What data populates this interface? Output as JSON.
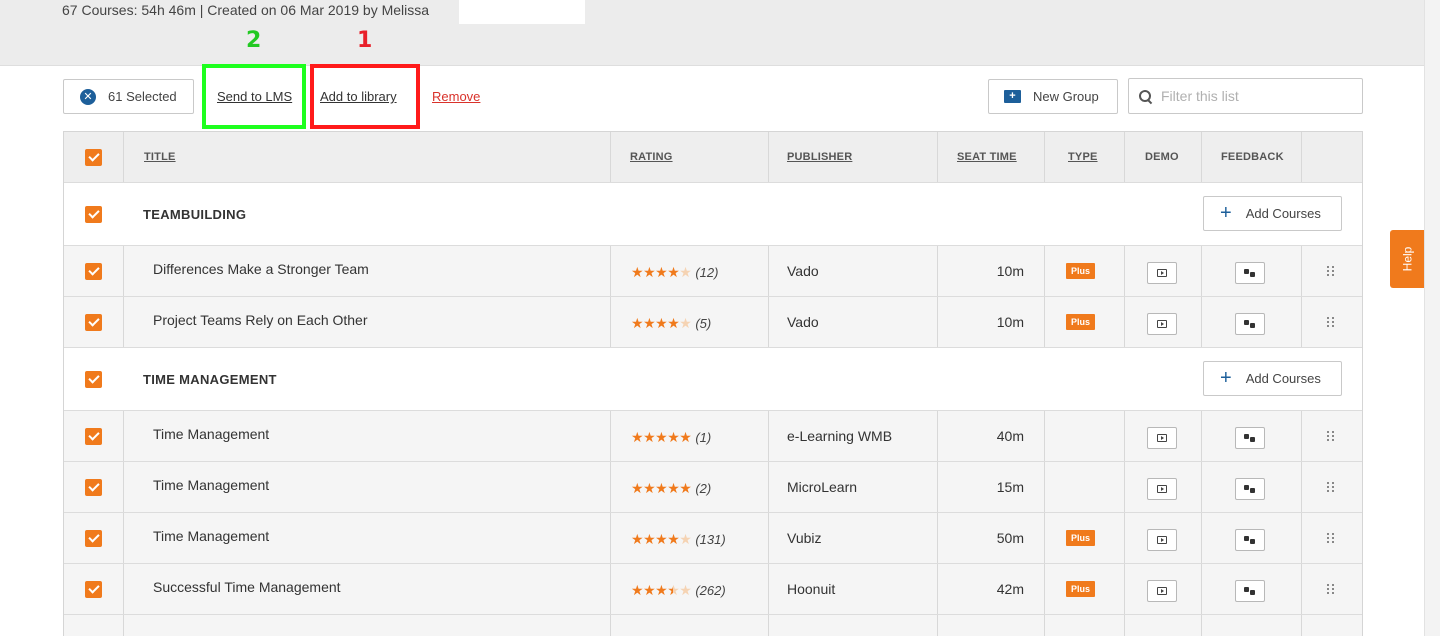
{
  "header": {
    "meta": "67 Courses: 54h 46m | Created on 06 Mar 2019 by Melissa"
  },
  "annotations": {
    "green_label": "2",
    "red_label": "1"
  },
  "toolbar": {
    "selected_label": "61 Selected",
    "send_to_lms": "Send to LMS",
    "add_to_library": "Add to library",
    "remove": "Remove",
    "new_group": "New Group",
    "filter_placeholder": "Filter this list"
  },
  "columns": {
    "title": "TITLE",
    "rating": "RATING",
    "publisher": "PUBLISHER",
    "seat_time": "SEAT TIME",
    "type": "TYPE",
    "demo": "DEMO",
    "feedback": "FEEDBACK"
  },
  "add_courses_label": "Add Courses",
  "groups": [
    {
      "name": "TEAMBUILDING",
      "courses": [
        {
          "title": "Differences Make a Stronger Team",
          "rating": 4,
          "rating_count": "(12)",
          "publisher": "Vado",
          "seat_time": "10m",
          "type": "Plus"
        },
        {
          "title": "Project Teams Rely on Each Other",
          "rating": 4,
          "rating_count": "(5)",
          "publisher": "Vado",
          "seat_time": "10m",
          "type": "Plus"
        }
      ]
    },
    {
      "name": "TIME MANAGEMENT",
      "courses": [
        {
          "title": "Time Management",
          "rating": 5,
          "rating_count": "(1)",
          "publisher": "e-Learning WMB",
          "seat_time": "40m",
          "type": ""
        },
        {
          "title": "Time Management",
          "rating": 5,
          "rating_count": "(2)",
          "publisher": "MicroLearn",
          "seat_time": "15m",
          "type": ""
        },
        {
          "title": "Time Management",
          "rating": 4,
          "rating_count": "(131)",
          "publisher": "Vubiz",
          "seat_time": "50m",
          "type": "Plus"
        },
        {
          "title": "Successful Time Management",
          "rating": 3.5,
          "rating_count": "(262)",
          "publisher": "Hoonuit",
          "seat_time": "42m",
          "type": "Plus"
        }
      ]
    }
  ],
  "help_label": "Help",
  "colors": {
    "accent": "#f07a1c",
    "brand_blue": "#1d5f9a",
    "remove_red": "#d9322b"
  }
}
